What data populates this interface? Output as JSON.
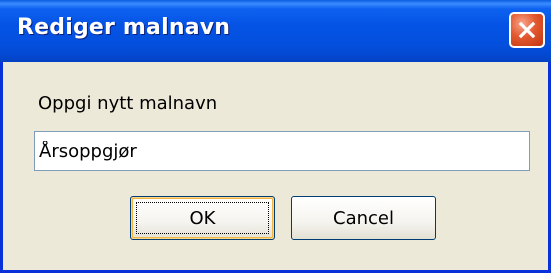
{
  "dialog": {
    "title": "Rediger malnavn",
    "prompt_label": "Oppgi nytt malnavn",
    "input_value": "Årsoppgjør",
    "ok_label": "OK",
    "cancel_label": "Cancel"
  },
  "icons": {
    "close": "close-icon"
  },
  "colors": {
    "titlebar": "#0553e5",
    "window_border": "#0831d9",
    "dialog_face": "#ece9d8",
    "close_button": "#e2582f",
    "input_border": "#7f9db9",
    "button_border": "#003c74"
  }
}
